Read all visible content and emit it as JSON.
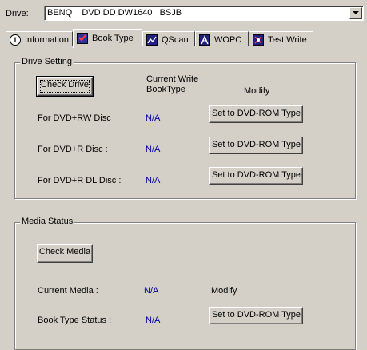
{
  "drive": {
    "label": "Drive:",
    "selected": "BENQ    DVD DD DW1640   BSJB"
  },
  "tabs": [
    {
      "label": "Information",
      "icon": "info-icon"
    },
    {
      "label": "Book Type",
      "icon": "check-disc-icon",
      "active": true
    },
    {
      "label": "QScan",
      "icon": "scan-graph-icon"
    },
    {
      "label": "WOPC",
      "icon": "wopc-icon"
    },
    {
      "label": "Test Write",
      "icon": "test-write-icon"
    }
  ],
  "drive_setting": {
    "title": "Drive Setting",
    "check_button": "Check Drive",
    "col_current": "Current Write",
    "col_current2": "BookType",
    "col_modify": "Modify",
    "rows": [
      {
        "label": "For DVD+RW Disc",
        "value": "N/A",
        "button": "Set to DVD-ROM Type"
      },
      {
        "label": "For DVD+R Disc :",
        "value": "N/A",
        "button": "Set to DVD-ROM Type"
      },
      {
        "label": "For DVD+R DL Disc :",
        "value": "N/A",
        "button": "Set to DVD-ROM Type"
      }
    ]
  },
  "media_status": {
    "title": "Media Status",
    "check_button": "Check Media",
    "current_media_label": "Current Media :",
    "current_media_value": "N/A",
    "modify_label": "Modify",
    "book_type_label": "Book Type Status :",
    "book_type_value": "N/A",
    "button": "Set to DVD-ROM Type"
  },
  "colors": {
    "face": "#d4d0c8",
    "value_text": "#0000a0"
  }
}
